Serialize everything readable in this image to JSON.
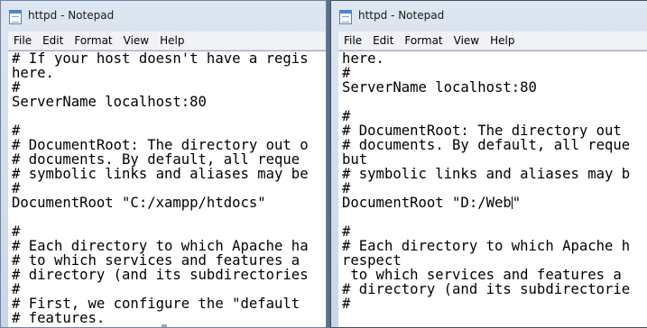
{
  "left_window": {
    "title": "httpd - Notepad",
    "menu": [
      "File",
      "Edit",
      "Format",
      "View",
      "Help"
    ],
    "lines": [
      "# If your host doesn't have a regis",
      "here.",
      "#",
      "ServerName localhost:80",
      "",
      "#",
      "# DocumentRoot: The directory out o",
      "# documents. By default, all reque",
      "# symbolic links and aliases may be",
      "#",
      "DocumentRoot \"C:/xampp/htdocs\"",
      "",
      "#",
      "# Each directory to which Apache ha",
      "# to which services and features a",
      "# directory (and its subdirectories",
      "#",
      "# First, we configure the \"default",
      "# features."
    ]
  },
  "right_window": {
    "title": "httpd - Notepad",
    "menu": [
      "File",
      "Edit",
      "Format",
      "View",
      "Help"
    ],
    "lines_before_caret": [
      "here.",
      "#",
      "ServerName localhost:80",
      "",
      "#",
      "# DocumentRoot: The directory out",
      "# documents. By default, all reque",
      "but",
      "# symbolic links and aliases may b",
      "#"
    ],
    "caret_line_text": "DocumentRoot \"D:/Web",
    "caret_line_after": "\"",
    "lines_after_caret": [
      "",
      "#",
      "# Each directory to which Apache h",
      "respect",
      " to which services and features a",
      "# directory (and its subdirectorie",
      "#"
    ]
  }
}
